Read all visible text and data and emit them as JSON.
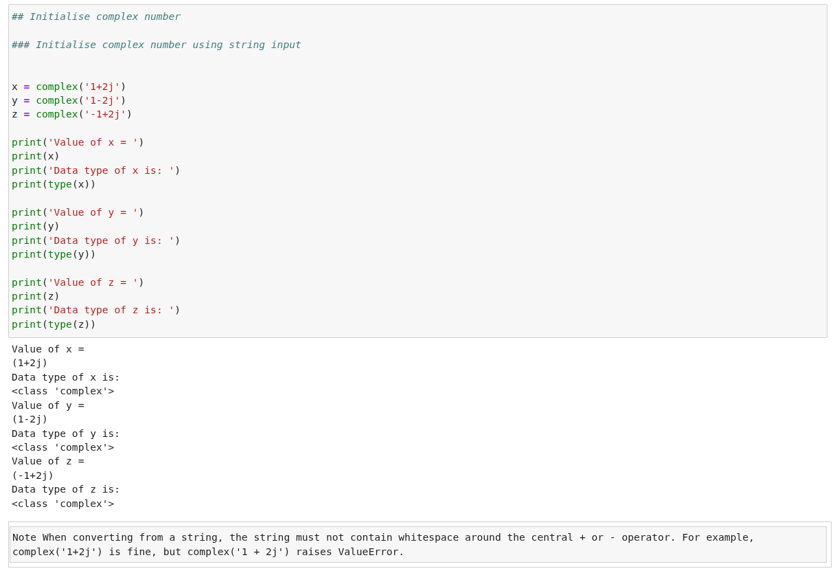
{
  "code_cell": {
    "lines": [
      {
        "kind": "code",
        "tokens": [
          {
            "kind": "comment",
            "text": "## Initialise complex number"
          }
        ]
      },
      {
        "kind": "blank"
      },
      {
        "kind": "code",
        "tokens": [
          {
            "kind": "comment",
            "text": "### Initialise complex number using string input"
          }
        ]
      },
      {
        "kind": "blank"
      },
      {
        "kind": "blank"
      },
      {
        "kind": "code",
        "tokens": [
          {
            "kind": "name",
            "text": "x"
          },
          {
            "kind": "op",
            "text": " = "
          },
          {
            "kind": "builtin",
            "text": "complex"
          },
          {
            "kind": "name",
            "text": "("
          },
          {
            "kind": "string",
            "text": "'1+2j'"
          },
          {
            "kind": "name",
            "text": ")"
          }
        ]
      },
      {
        "kind": "code",
        "tokens": [
          {
            "kind": "name",
            "text": "y"
          },
          {
            "kind": "op",
            "text": " = "
          },
          {
            "kind": "builtin",
            "text": "complex"
          },
          {
            "kind": "name",
            "text": "("
          },
          {
            "kind": "string",
            "text": "'1-2j'"
          },
          {
            "kind": "name",
            "text": ")"
          }
        ]
      },
      {
        "kind": "code",
        "tokens": [
          {
            "kind": "name",
            "text": "z"
          },
          {
            "kind": "op",
            "text": " = "
          },
          {
            "kind": "builtin",
            "text": "complex"
          },
          {
            "kind": "name",
            "text": "("
          },
          {
            "kind": "string",
            "text": "'-1+2j'"
          },
          {
            "kind": "name",
            "text": ")"
          }
        ]
      },
      {
        "kind": "blank"
      },
      {
        "kind": "code",
        "tokens": [
          {
            "kind": "builtin",
            "text": "print"
          },
          {
            "kind": "name",
            "text": "("
          },
          {
            "kind": "string",
            "text": "'Value of x = '"
          },
          {
            "kind": "name",
            "text": ")"
          }
        ]
      },
      {
        "kind": "code",
        "tokens": [
          {
            "kind": "builtin",
            "text": "print"
          },
          {
            "kind": "name",
            "text": "(x)"
          }
        ]
      },
      {
        "kind": "code",
        "tokens": [
          {
            "kind": "builtin",
            "text": "print"
          },
          {
            "kind": "name",
            "text": "("
          },
          {
            "kind": "string",
            "text": "'Data type of x is: '"
          },
          {
            "kind": "name",
            "text": ")"
          }
        ]
      },
      {
        "kind": "code",
        "tokens": [
          {
            "kind": "builtin",
            "text": "print"
          },
          {
            "kind": "name",
            "text": "("
          },
          {
            "kind": "builtin",
            "text": "type"
          },
          {
            "kind": "name",
            "text": "(x))"
          }
        ]
      },
      {
        "kind": "blank"
      },
      {
        "kind": "code",
        "tokens": [
          {
            "kind": "builtin",
            "text": "print"
          },
          {
            "kind": "name",
            "text": "("
          },
          {
            "kind": "string",
            "text": "'Value of y = '"
          },
          {
            "kind": "name",
            "text": ")"
          }
        ]
      },
      {
        "kind": "code",
        "tokens": [
          {
            "kind": "builtin",
            "text": "print"
          },
          {
            "kind": "name",
            "text": "(y)"
          }
        ]
      },
      {
        "kind": "code",
        "tokens": [
          {
            "kind": "builtin",
            "text": "print"
          },
          {
            "kind": "name",
            "text": "("
          },
          {
            "kind": "string",
            "text": "'Data type of y is: '"
          },
          {
            "kind": "name",
            "text": ")"
          }
        ]
      },
      {
        "kind": "code",
        "tokens": [
          {
            "kind": "builtin",
            "text": "print"
          },
          {
            "kind": "name",
            "text": "("
          },
          {
            "kind": "builtin",
            "text": "type"
          },
          {
            "kind": "name",
            "text": "(y))"
          }
        ]
      },
      {
        "kind": "blank"
      },
      {
        "kind": "code",
        "tokens": [
          {
            "kind": "builtin",
            "text": "print"
          },
          {
            "kind": "name",
            "text": "("
          },
          {
            "kind": "string",
            "text": "'Value of z = '"
          },
          {
            "kind": "name",
            "text": ")"
          }
        ]
      },
      {
        "kind": "code",
        "tokens": [
          {
            "kind": "builtin",
            "text": "print"
          },
          {
            "kind": "name",
            "text": "(z)"
          }
        ]
      },
      {
        "kind": "code",
        "tokens": [
          {
            "kind": "builtin",
            "text": "print"
          },
          {
            "kind": "name",
            "text": "("
          },
          {
            "kind": "string",
            "text": "'Data type of z is: '"
          },
          {
            "kind": "name",
            "text": ")"
          }
        ]
      },
      {
        "kind": "code",
        "tokens": [
          {
            "kind": "builtin",
            "text": "print"
          },
          {
            "kind": "name",
            "text": "("
          },
          {
            "kind": "builtin",
            "text": "type"
          },
          {
            "kind": "name",
            "text": "(z))"
          }
        ]
      }
    ]
  },
  "output": [
    "Value of x =",
    "(1+2j)",
    "Data type of x is:",
    "<class 'complex'>",
    "Value of y =",
    "(1-2j)",
    "Data type of y is:",
    "<class 'complex'>",
    "Value of z =",
    "(-1+2j)",
    "Data type of z is:",
    "<class 'complex'>"
  ],
  "note_cell": {
    "lines": [
      "Note When converting from a string, the string must not contain whitespace around the central + or - operator. For example,",
      "complex('1+2j') is fine, but complex('1 + 2j') raises ValueError."
    ]
  }
}
